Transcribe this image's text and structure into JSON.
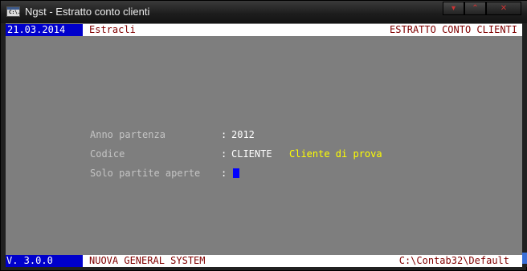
{
  "window": {
    "title": "Ngst - Estratto conto clienti",
    "icon_text": "C:\\.",
    "controls": {
      "minimize_glyph": "▾",
      "maximize_glyph": "⌃",
      "close_glyph": "✕"
    }
  },
  "header": {
    "date": "21.03.2014",
    "program": "Estracli",
    "screen_title": "ESTRATTO CONTO CLIENTI"
  },
  "form": {
    "anno_label": "Anno partenza",
    "anno_value": "2012",
    "codice_label": "Codice",
    "codice_value": "CLIENTE",
    "codice_description": "Cliente di prova",
    "solo_label": "Solo partite aperte",
    "separator": ":"
  },
  "footer": {
    "version": "V. 3.0.0",
    "system": "NUOVA GENERAL SYSTEM",
    "path": "C:\\Contab32\\Default"
  },
  "colors": {
    "background": "#7e7e7e",
    "header_blue": "#0000cc",
    "accent_red": "#800000",
    "highlight_yellow": "#ffff00"
  }
}
